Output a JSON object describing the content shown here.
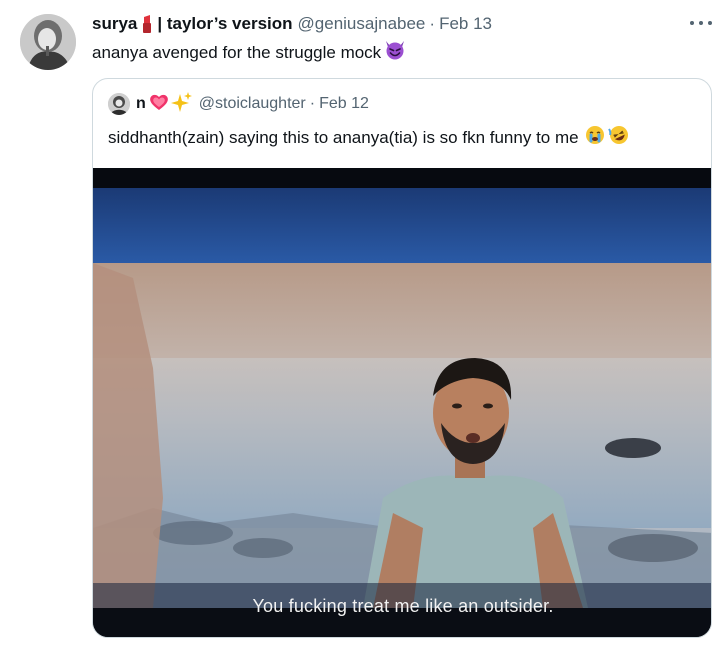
{
  "tweet": {
    "display_name": "surya",
    "display_name_suffix": "| taylor’s version",
    "handle": "@geniusajnabee",
    "separator": "·",
    "date": "Feb 13",
    "text": "ananya avenged for the struggle mock",
    "more_icon": "more-horizontal-icon",
    "text_emoji_icon": "smiling-devil-emoji"
  },
  "quoted_tweet": {
    "display_name": "n",
    "handle": "@stoiclaughter",
    "separator": "·",
    "date": "Feb 12",
    "text": "siddhanth(zain) saying this to ananya(tia) is so fkn funny to me",
    "name_emoji_icons": [
      "red-heart-emoji",
      "sparkles-emoji"
    ],
    "text_emoji_icons": [
      "crying-face-emoji",
      "rofl-emoji"
    ]
  },
  "media": {
    "subtitle": "You fucking treat me like an outsider."
  },
  "colors": {
    "text_primary": "#0f1419",
    "text_secondary": "#536471",
    "border": "#cfd9de"
  }
}
